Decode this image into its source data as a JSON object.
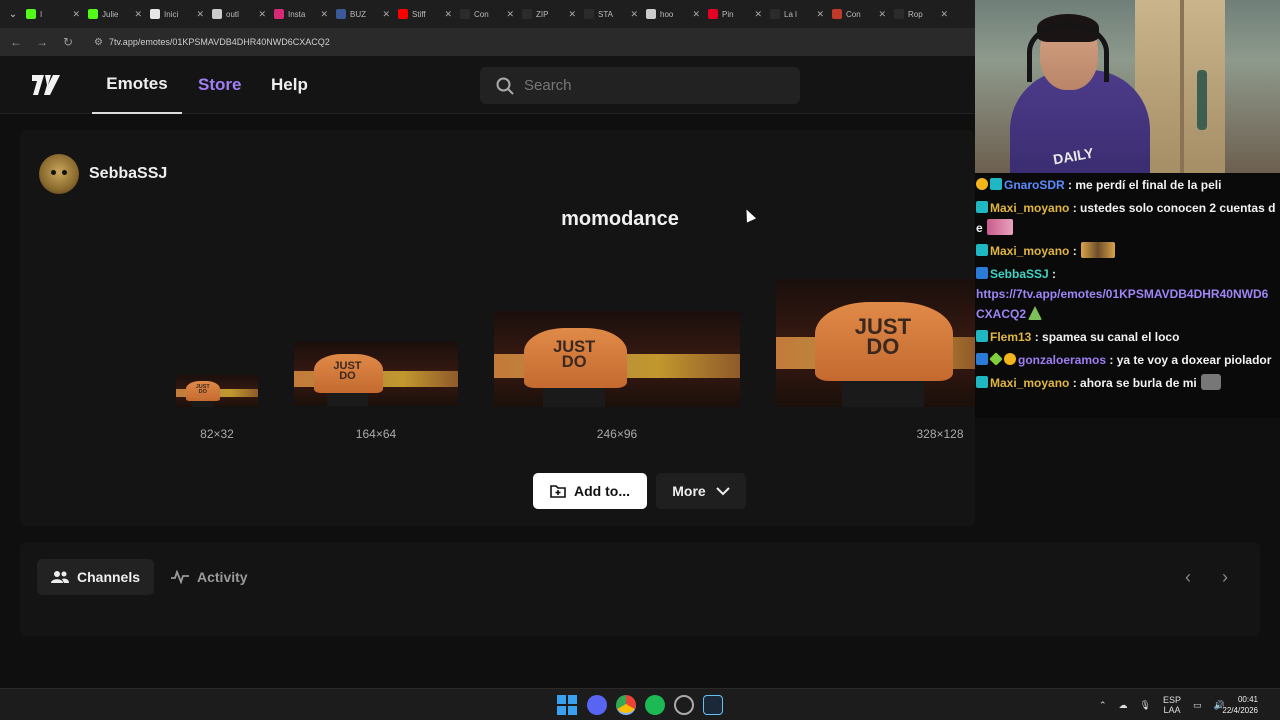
{
  "browser": {
    "tabs": [
      {
        "label": "I",
        "color": "#53fc18"
      },
      {
        "label": "Julie",
        "color": "#53fc18"
      },
      {
        "label": "Inici",
        "color": "#e7e7e7"
      },
      {
        "label": "outl",
        "color": "#cccccc"
      },
      {
        "label": "Insta",
        "color": "#d62976"
      },
      {
        "label": "BUZ",
        "color": "#3b5998"
      },
      {
        "label": "Stiff",
        "color": "#ff0000"
      },
      {
        "label": "Con",
        "color": "#2b2b2b"
      },
      {
        "label": "ZIP",
        "color": "#2b2b2b"
      },
      {
        "label": "STA",
        "color": "#2b2b2b"
      },
      {
        "label": "hoo",
        "color": "#cccccc"
      },
      {
        "label": "Pin",
        "color": "#e60023"
      },
      {
        "label": "La l",
        "color": "#2b2b2b"
      },
      {
        "label": "Con",
        "color": "#c0392b"
      },
      {
        "label": "Rop",
        "color": "#2b2b2b"
      }
    ],
    "url": "7tv.app/emotes/01KPSMAVDB4DHR40NWD6CXACQ2"
  },
  "header": {
    "nav": {
      "emotes": "Emotes",
      "store": "Store",
      "help": "Help"
    },
    "search_placeholder": "Search"
  },
  "emote": {
    "owner": "SebbaSSJ",
    "title": "momodance",
    "sizes": [
      "82×32",
      "164×64",
      "246×96",
      "328×128"
    ],
    "shirt_text": "JUST DO",
    "add_label": "Add to...",
    "more_label": "More"
  },
  "lower": {
    "channels_label": "Channels",
    "activity_label": "Activity"
  },
  "webcam": {
    "shirt_logo": "DAILY"
  },
  "chat": {
    "messages": [
      {
        "user": "GnaroSDR",
        "color": "#5a8bff",
        "text": ": me perdí el final de la peli"
      },
      {
        "user": "Maxi_moyano",
        "color": "#e0b640",
        "text": ": ustedes solo conocen 2 cuentas de"
      },
      {
        "user": "Maxi_moyano",
        "color": "#e0b640",
        "text": ":"
      },
      {
        "user": "SebbaSSJ",
        "color": "#3fd4c5",
        "text": ":",
        "link": "https://7tv.app/emotes/01KPSMAVDB4DHR40NWD6CXACQ2"
      },
      {
        "user": "Flem13",
        "color": "#e0b640",
        "text": ": spamea su canal el loco"
      },
      {
        "user": "gonzaloeramos",
        "color": "#9f7df5",
        "text": ": ya te voy a doxear piolador"
      },
      {
        "user": "Maxi_moyano",
        "color": "#e0b640",
        "text": ": ahora se burla de mi"
      }
    ]
  },
  "taskbar": {
    "lang_top": "ESP",
    "lang_bottom": "LAA",
    "time": "00:41",
    "date": "22/4/2026"
  }
}
